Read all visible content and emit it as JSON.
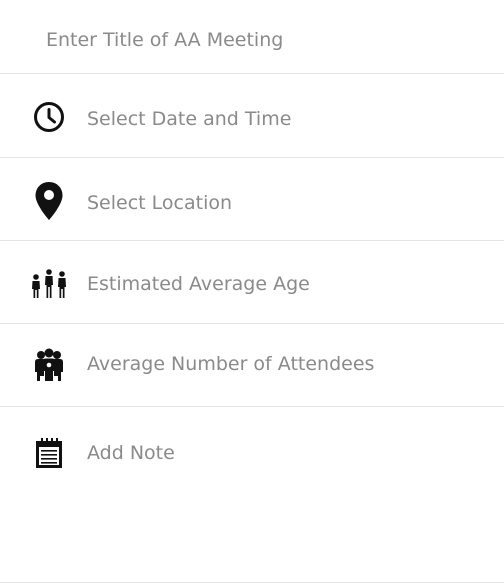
{
  "form": {
    "title_placeholder": "Enter Title of AA Meeting",
    "title_value": ""
  },
  "rows": [
    {
      "label": "Select Date and Time",
      "icon": "clock-icon"
    },
    {
      "label": "Select Location",
      "icon": "location-pin-icon"
    },
    {
      "label": "Estimated Average Age",
      "icon": "family-icon"
    },
    {
      "label": "Average Number of Attendees",
      "icon": "group-icon"
    },
    {
      "label": "Add Note",
      "icon": "notepad-icon"
    }
  ]
}
